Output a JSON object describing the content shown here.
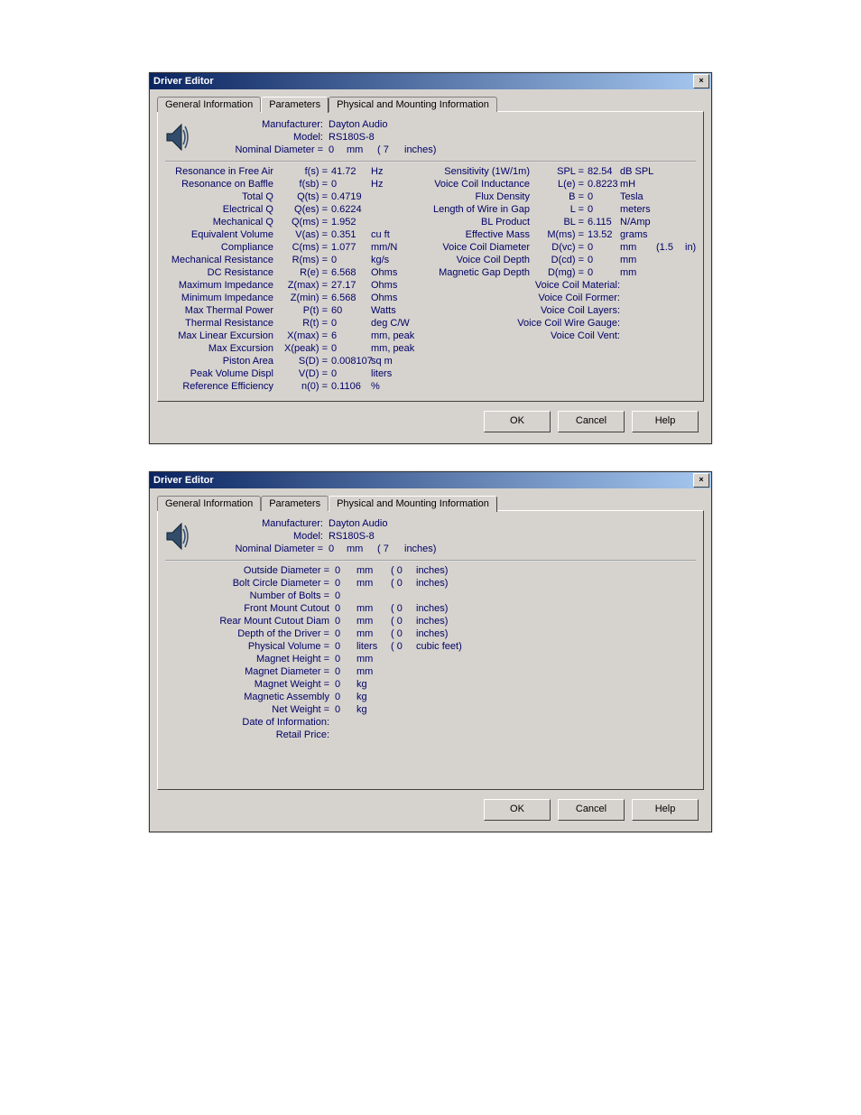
{
  "window1": {
    "title": "Driver Editor",
    "close": "×",
    "tabs": [
      "General Information",
      "Parameters",
      "Physical and Mounting Information"
    ],
    "active_tab": 1,
    "header": {
      "manufacturer_label": "Manufacturer:",
      "manufacturer": "Dayton Audio",
      "model_label": "Model:",
      "model": "RS180S-8",
      "nominal_label": "Nominal Diameter =",
      "nominal_mm": "0",
      "mm": "mm",
      "nominal_paren": "( 7",
      "inches": "inches)"
    },
    "left": [
      {
        "label": "Resonance in Free Air",
        "sym": "f(s) =",
        "val": "41.72",
        "unit": "Hz"
      },
      {
        "label": "Resonance on Baffle",
        "sym": "f(sb) =",
        "val": "0",
        "unit": "Hz"
      },
      {
        "label": "Total Q",
        "sym": "Q(ts) =",
        "val": "0.4719",
        "unit": ""
      },
      {
        "label": "Electrical Q",
        "sym": "Q(es) =",
        "val": "0.6224",
        "unit": ""
      },
      {
        "label": "Mechanical Q",
        "sym": "Q(ms) =",
        "val": "1.952",
        "unit": ""
      },
      {
        "label": "Equivalent Volume",
        "sym": "V(as) =",
        "val": "0.351",
        "unit": "cu ft"
      },
      {
        "label": "Compliance",
        "sym": "C(ms) =",
        "val": "1.077",
        "unit": "mm/N"
      },
      {
        "label": "Mechanical Resistance",
        "sym": "R(ms) =",
        "val": "0",
        "unit": "kg/s"
      },
      {
        "label": "DC Resistance",
        "sym": "R(e) =",
        "val": "6.568",
        "unit": "Ohms"
      },
      {
        "label": "Maximum Impedance",
        "sym": "Z(max) =",
        "val": "27.17",
        "unit": "Ohms"
      },
      {
        "label": "Minimum Impedance",
        "sym": "Z(min) =",
        "val": "6.568",
        "unit": "Ohms"
      },
      {
        "label": "Max Thermal Power",
        "sym": "P(t) =",
        "val": "60",
        "unit": "Watts"
      },
      {
        "label": "Thermal Resistance",
        "sym": "R(t) =",
        "val": "0",
        "unit": "deg C/W"
      },
      {
        "label": "Max Linear Excursion",
        "sym": "X(max) =",
        "val": "6",
        "unit": "mm, peak"
      },
      {
        "label": "Max Excursion",
        "sym": "X(peak) =",
        "val": "0",
        "unit": "mm, peak"
      },
      {
        "label": "Piston Area",
        "sym": "S(D) =",
        "val": "0.008107",
        "unit": "sq m"
      },
      {
        "label": "Peak Volume Displ",
        "sym": "V(D) =",
        "val": "0",
        "unit": "liters"
      },
      {
        "label": "Reference Efficiency",
        "sym": "n(0) =",
        "val": "0.1106",
        "unit": "%"
      }
    ],
    "right": [
      {
        "label": "Sensitivity (1W/1m)",
        "sym": "SPL =",
        "val": "82.54",
        "unit": "dB SPL"
      },
      {
        "label": "Voice Coil Inductance",
        "sym": "L(e) =",
        "val": "0.8223",
        "unit": "mH"
      },
      {
        "label": "Flux Density",
        "sym": "B =",
        "val": "0",
        "unit": "Tesla"
      },
      {
        "label": "Length of Wire in Gap",
        "sym": "L =",
        "val": "0",
        "unit": "meters"
      },
      {
        "label": "BL Product",
        "sym": "BL =",
        "val": "6.115",
        "unit": "N/Amp"
      },
      {
        "label": "Effective Mass",
        "sym": "M(ms) =",
        "val": "13.52",
        "unit": "grams"
      },
      {
        "label": "Voice Coil Diameter",
        "sym": "D(vc) =",
        "val": "0",
        "unit": "mm",
        "extra1": "(1.5",
        "extra2": "in)"
      },
      {
        "label": "Voice Coil Depth",
        "sym": "D(cd) =",
        "val": "0",
        "unit": "mm"
      },
      {
        "label": "Magnetic Gap Depth",
        "sym": "D(mg) =",
        "val": "0",
        "unit": "mm"
      },
      {
        "label": "Voice Coil Material:",
        "sym": "",
        "val": "",
        "unit": ""
      },
      {
        "label": "Voice Coil Former:",
        "sym": "",
        "val": "",
        "unit": ""
      },
      {
        "label": "Voice Coil Layers:",
        "sym": "",
        "val": "",
        "unit": ""
      },
      {
        "label": "Voice Coil Wire Gauge:",
        "sym": "",
        "val": "",
        "unit": ""
      },
      {
        "label": "Voice Coil Vent:",
        "sym": "",
        "val": "",
        "unit": ""
      }
    ],
    "buttons": {
      "ok": "OK",
      "cancel": "Cancel",
      "help": "Help"
    }
  },
  "window2": {
    "title": "Driver Editor",
    "close": "×",
    "tabs": [
      "General Information",
      "Parameters",
      "Physical and Mounting Information"
    ],
    "active_tab": 2,
    "header": {
      "manufacturer_label": "Manufacturer:",
      "manufacturer": "Dayton Audio",
      "model_label": "Model:",
      "model": "RS180S-8",
      "nominal_label": "Nominal Diameter =",
      "nominal_mm": "0",
      "mm": "mm",
      "nominal_paren": "( 7",
      "inches": "inches)"
    },
    "rows": [
      {
        "label": "Outside Diameter =",
        "val": "0",
        "unit": "mm",
        "paren": "( 0",
        "unit2": "inches)"
      },
      {
        "label": "Bolt Circle Diameter =",
        "val": "0",
        "unit": "mm",
        "paren": "( 0",
        "unit2": "inches)"
      },
      {
        "label": "Number of Bolts =",
        "val": "0",
        "unit": "",
        "paren": "",
        "unit2": ""
      },
      {
        "label": "Front Mount Cutout",
        "val": "0",
        "unit": "mm",
        "paren": "( 0",
        "unit2": "inches)"
      },
      {
        "label": "Rear Mount Cutout Diam",
        "val": "0",
        "unit": "mm",
        "paren": "( 0",
        "unit2": "inches)"
      },
      {
        "label": "Depth of the Driver =",
        "val": "0",
        "unit": "mm",
        "paren": "( 0",
        "unit2": "inches)"
      },
      {
        "label": "Physical Volume =",
        "val": "0",
        "unit": "liters",
        "paren": "( 0",
        "unit2": "cubic feet)"
      },
      {
        "label": "Magnet Height =",
        "val": "0",
        "unit": "mm",
        "paren": "",
        "unit2": ""
      },
      {
        "label": "Magnet Diameter =",
        "val": "0",
        "unit": "mm",
        "paren": "",
        "unit2": ""
      },
      {
        "label": "Magnet Weight =",
        "val": "0",
        "unit": "kg",
        "paren": "",
        "unit2": ""
      },
      {
        "label": "Magnetic Assembly",
        "val": "0",
        "unit": "kg",
        "paren": "",
        "unit2": ""
      },
      {
        "label": "Net Weight =",
        "val": "0",
        "unit": "kg",
        "paren": "",
        "unit2": ""
      },
      {
        "label": "Date of Information:",
        "val": "",
        "unit": "",
        "paren": "",
        "unit2": ""
      },
      {
        "label": "Retail Price:",
        "val": "",
        "unit": "",
        "paren": "",
        "unit2": ""
      }
    ],
    "buttons": {
      "ok": "OK",
      "cancel": "Cancel",
      "help": "Help"
    }
  }
}
